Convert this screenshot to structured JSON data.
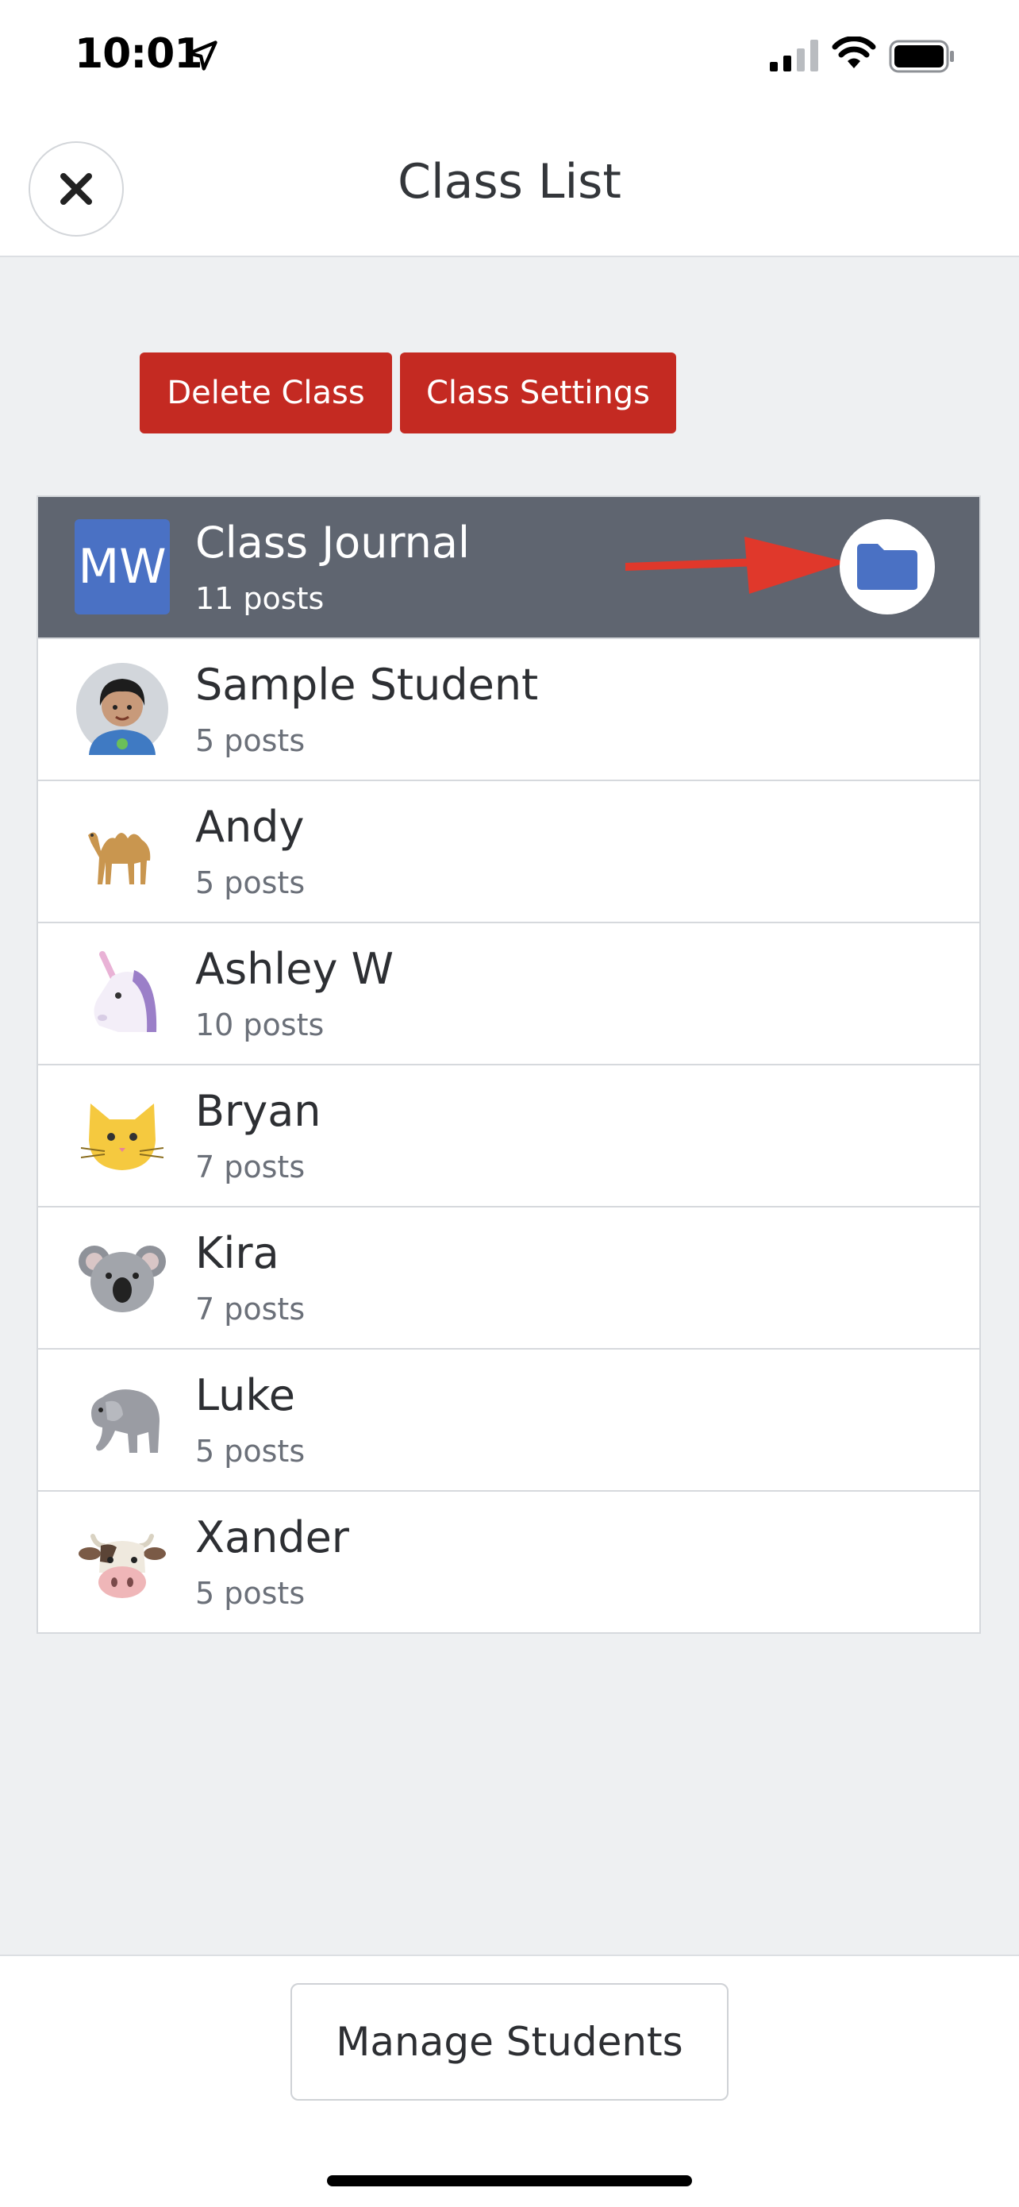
{
  "status_bar": {
    "time": "10:01"
  },
  "header": {
    "title": "Class List"
  },
  "actions": {
    "delete_label": "Delete Class",
    "settings_label": "Class Settings"
  },
  "list": {
    "items": [
      {
        "name": "Class Journal",
        "count": "11 posts",
        "avatar": "initials",
        "initials": "MW",
        "selected": true
      },
      {
        "name": "Sample Student",
        "count": "5 posts",
        "avatar": "student-avatar-icon"
      },
      {
        "name": "Andy",
        "count": "5 posts",
        "avatar": "camel-icon"
      },
      {
        "name": "Ashley W",
        "count": "10 posts",
        "avatar": "unicorn-icon"
      },
      {
        "name": "Bryan",
        "count": "7 posts",
        "avatar": "cat-icon"
      },
      {
        "name": "Kira",
        "count": "7 posts",
        "avatar": "koala-icon"
      },
      {
        "name": "Luke",
        "count": "5 posts",
        "avatar": "elephant-icon"
      },
      {
        "name": "Xander",
        "count": "5 posts",
        "avatar": "cow-icon"
      }
    ]
  },
  "footer": {
    "manage_label": "Manage Students"
  },
  "colors": {
    "accent_red": "#c42a22",
    "selected_row": "#5f6570",
    "folder_blue": "#4a71c4",
    "arrow_red": "#e0382b"
  }
}
